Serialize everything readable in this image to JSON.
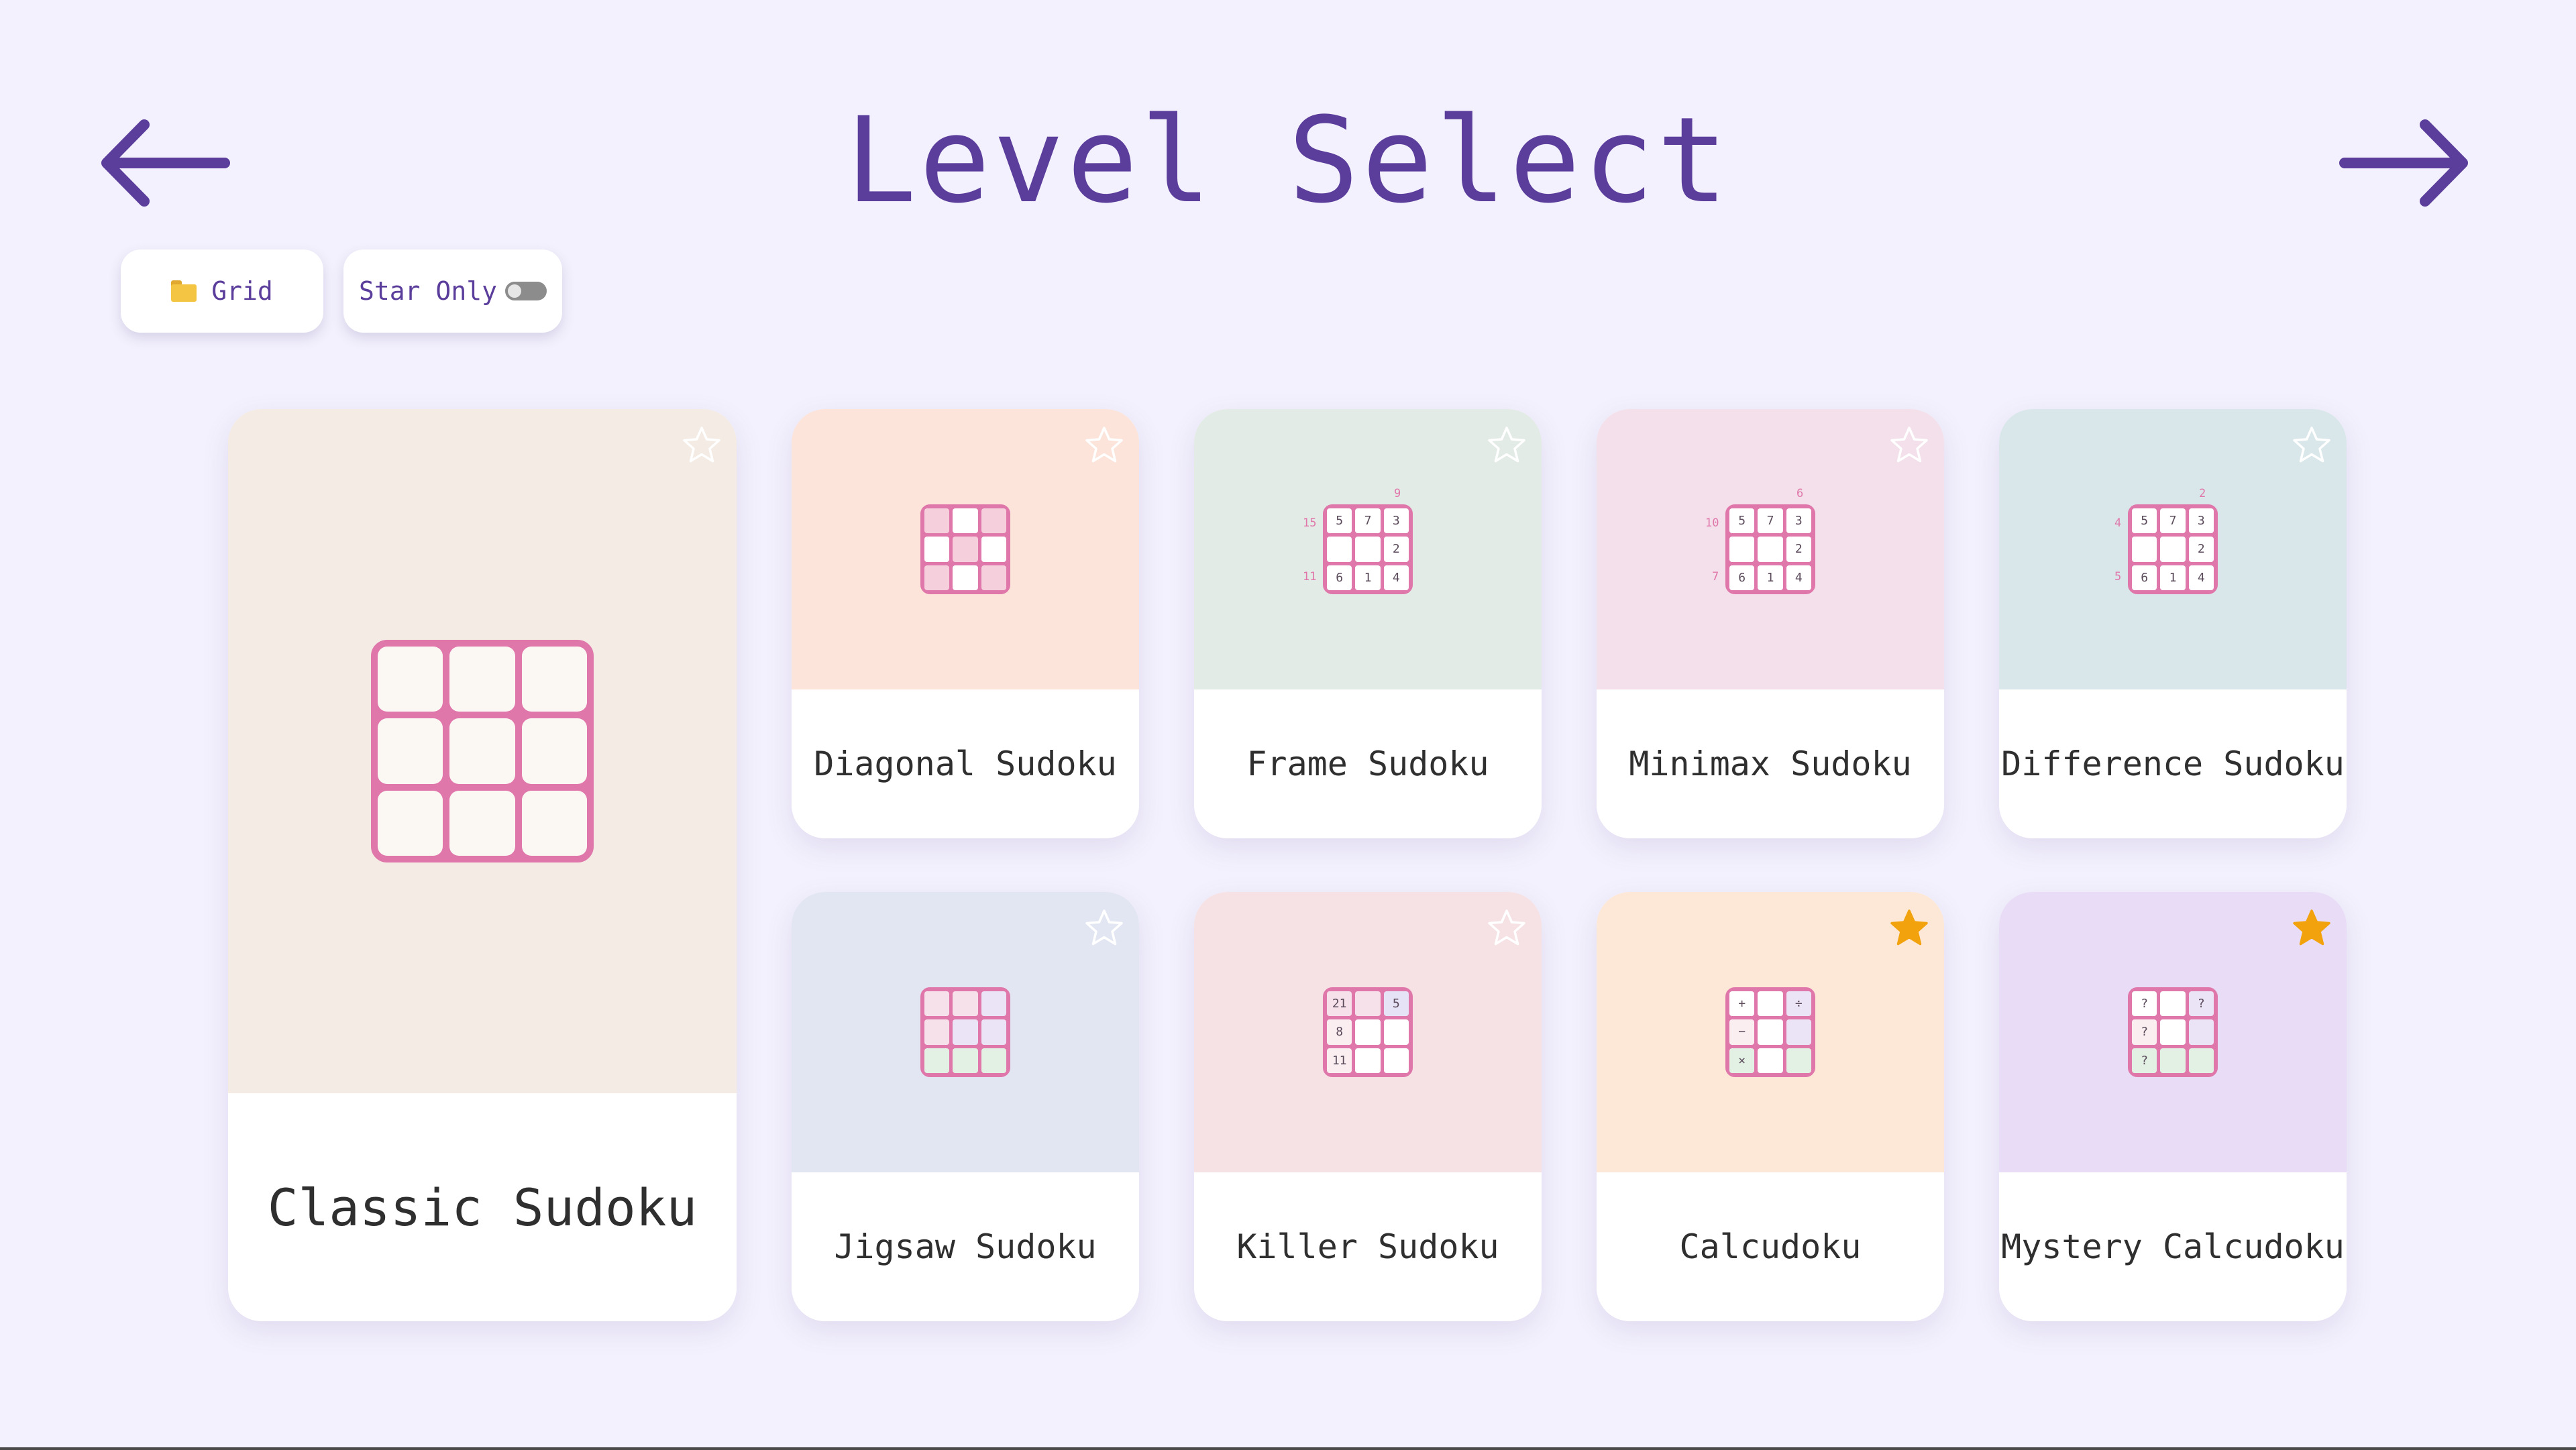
{
  "header": {
    "title": "Level Select"
  },
  "filters": {
    "grid_label": "Grid",
    "star_only_label": "Star Only",
    "star_only_on": false
  },
  "colors": {
    "accent": "#5b3d9b",
    "grid_pink": "#e077aa",
    "star_gold": "#f2a20c"
  },
  "levels": {
    "classic": {
      "name": "Classic Sudoku",
      "starred": false,
      "bg": "#f3ebe4"
    },
    "diagonal": {
      "name": "Diagonal Sudoku",
      "starred": false,
      "bg": "#fce4da"
    },
    "frame": {
      "name": "Frame Sudoku",
      "starred": false,
      "bg": "#e3ebe6",
      "cells": [
        "5",
        "7",
        "3",
        "",
        "",
        "2",
        "6",
        "1",
        "4"
      ],
      "top_clue": "9",
      "left_clues": [
        "15",
        "",
        "11"
      ]
    },
    "minimax": {
      "name": "Minimax Sudoku",
      "starred": false,
      "bg": "#f3e0ea",
      "cells": [
        "5",
        "7",
        "3",
        "",
        "",
        "2",
        "6",
        "1",
        "4"
      ],
      "top_clue": "6",
      "left_clues": [
        "10",
        "",
        "7"
      ]
    },
    "difference": {
      "name": "Difference Sudoku",
      "starred": false,
      "bg": "#d9e7ea",
      "cells": [
        "5",
        "7",
        "3",
        "",
        "",
        "2",
        "6",
        "1",
        "4"
      ],
      "top_clue": "2",
      "left_clues": [
        "4",
        "",
        "5"
      ]
    },
    "jigsaw": {
      "name": "Jigsaw Sudoku",
      "starred": false,
      "bg": "#e2e6f2"
    },
    "killer": {
      "name": "Killer Sudoku",
      "starred": false,
      "bg": "#f6e2e4",
      "cells": [
        "21",
        "",
        "5",
        "8",
        "",
        "",
        "11",
        "",
        ""
      ]
    },
    "calcudoku": {
      "name": "Calcudoku",
      "starred": true,
      "bg": "#fde8d8",
      "cells": [
        "+",
        "",
        "÷",
        "−",
        "",
        "",
        "×",
        "",
        ""
      ]
    },
    "mystery": {
      "name": "Mystery Calcudoku",
      "starred": true,
      "bg": "#e8dcf6",
      "cells": [
        "?",
        "",
        "?",
        "?",
        "",
        "",
        "?",
        "",
        ""
      ]
    }
  }
}
